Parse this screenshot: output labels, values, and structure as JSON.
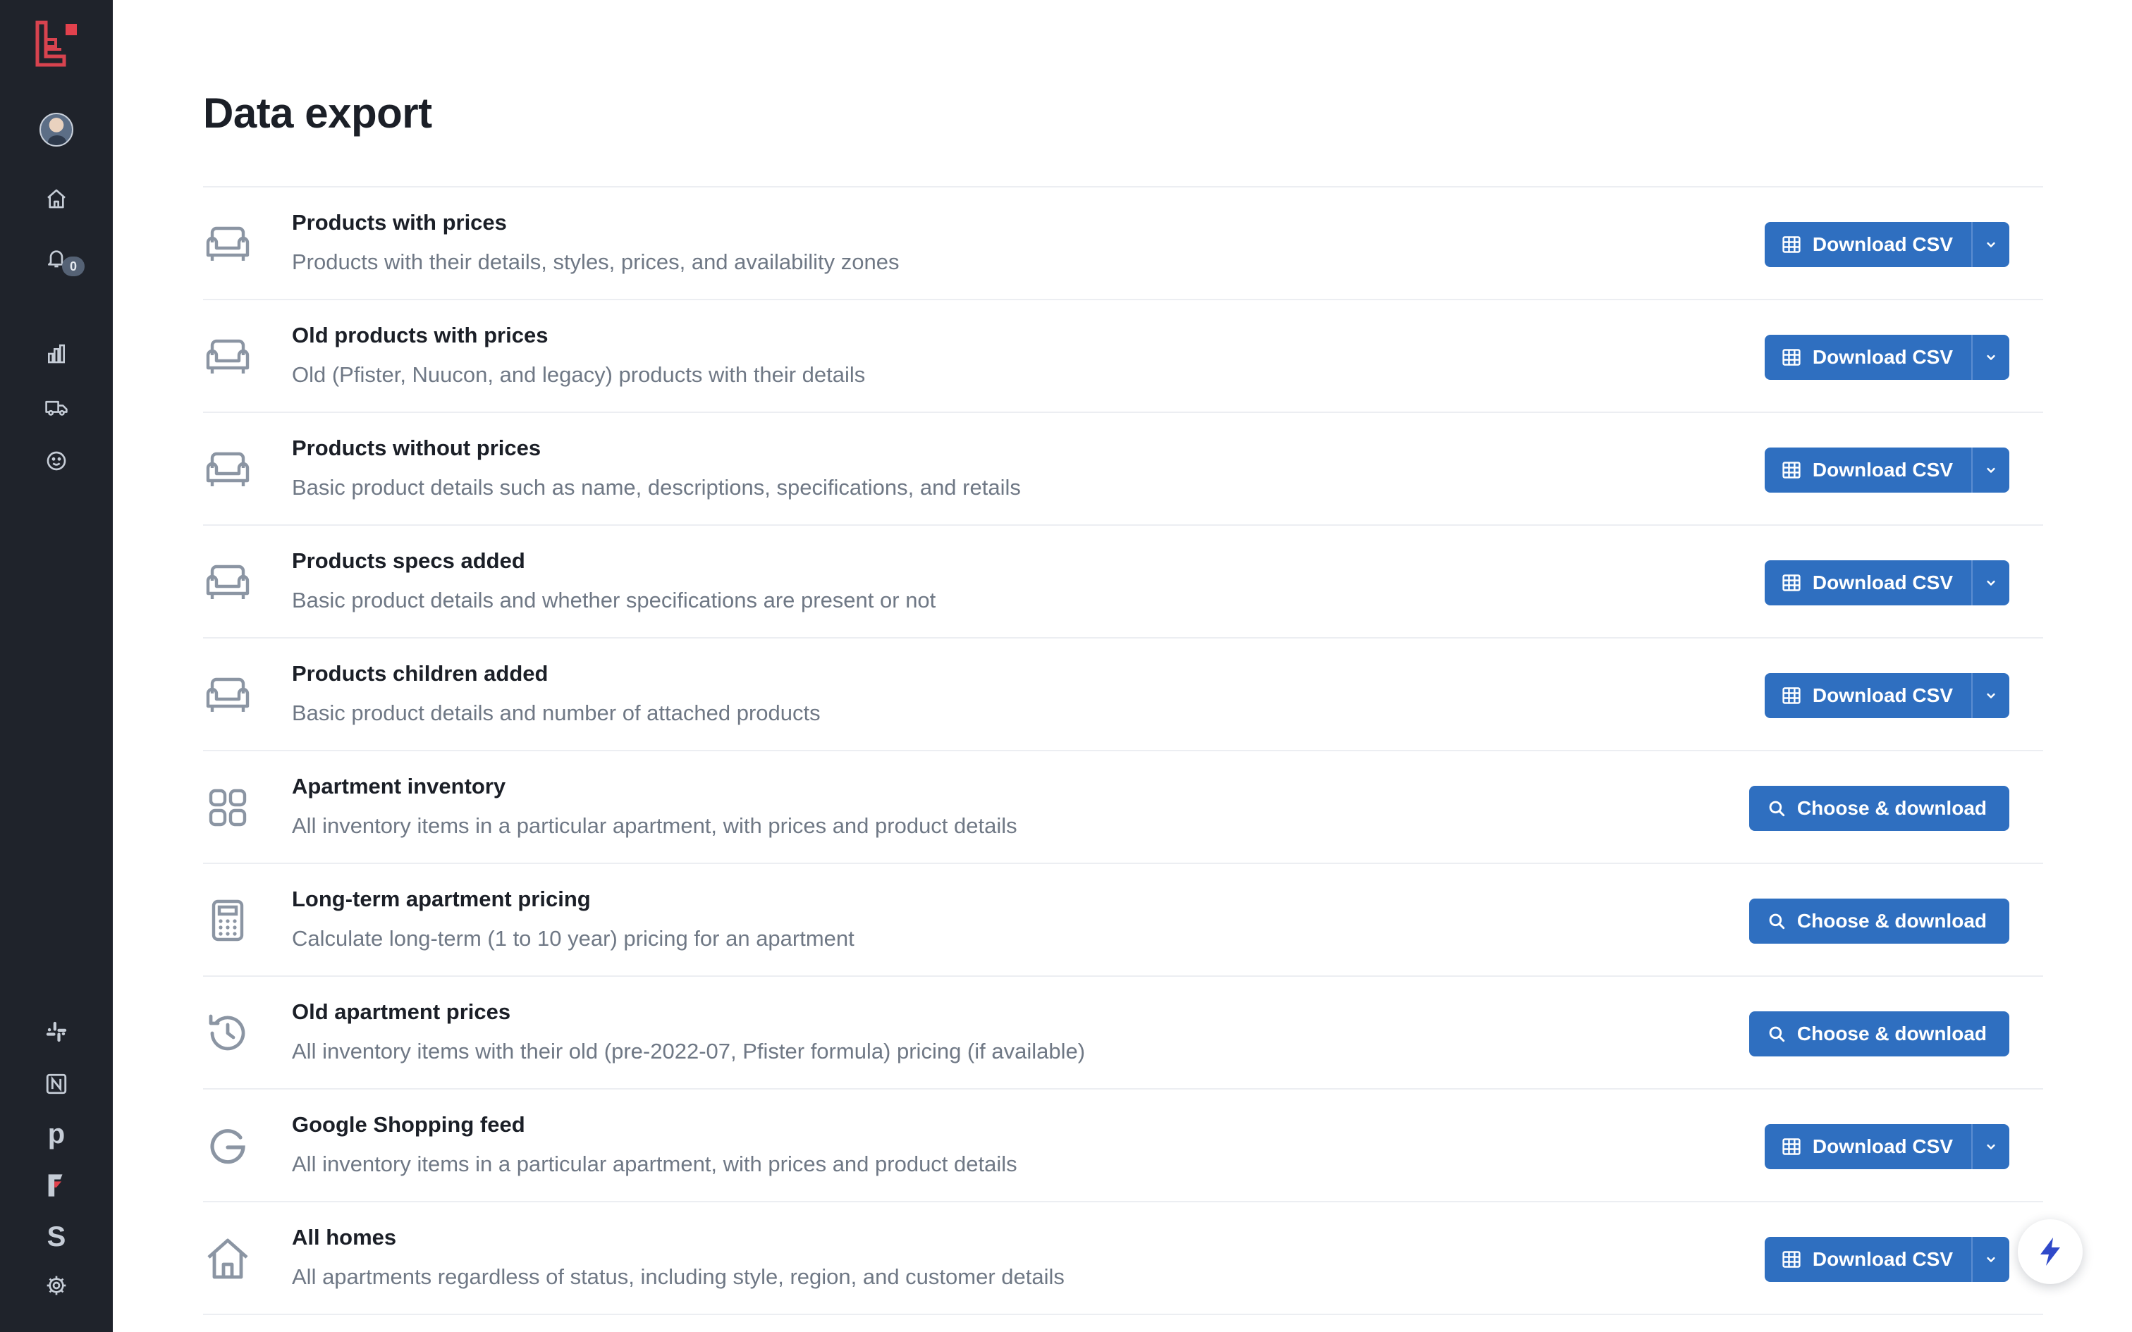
{
  "sidebar": {
    "notifications_count": "0",
    "external_letters": {
      "producthunt": "p",
      "stripe": "S"
    }
  },
  "page": {
    "title": "Data export"
  },
  "rows": [
    {
      "title": "Products with prices",
      "description": "Products with their details, styles, prices, and availability zones",
      "icon": "sofa-icon",
      "button": "Download CSV"
    },
    {
      "title": "Old products with prices",
      "description": "Old (Pfister, Nuucon, and legacy) products with their details",
      "icon": "sofa-icon",
      "button": "Download CSV"
    },
    {
      "title": "Products without prices",
      "description": "Basic product details such as name, descriptions, specifications, and retails",
      "icon": "sofa-icon",
      "button": "Download CSV"
    },
    {
      "title": "Products specs added",
      "description": "Basic product details and whether specifications are present or not",
      "icon": "sofa-icon",
      "button": "Download CSV"
    },
    {
      "title": "Products children added",
      "description": "Basic product details and number of attached products",
      "icon": "sofa-icon",
      "button": "Download CSV"
    },
    {
      "title": "Apartment inventory",
      "description": "All inventory items in a particular apartment, with prices and product details",
      "icon": "grid-icon",
      "button": "Choose & download"
    },
    {
      "title": "Long-term apartment pricing",
      "description": "Calculate long-term (1 to 10 year) pricing for an apartment",
      "icon": "calculator-icon",
      "button": "Choose & download"
    },
    {
      "title": "Old apartment prices",
      "description": "All inventory items with their old (pre-2022-07, Pfister formula) pricing (if available)",
      "icon": "history-icon",
      "button": "Choose & download"
    },
    {
      "title": "Google Shopping feed",
      "description": "All inventory items in a particular apartment, with prices and product details",
      "icon": "google-icon",
      "button": "Download CSV"
    },
    {
      "title": "All homes",
      "description": "All apartments regardless of status, including style, region, and customer details",
      "icon": "home-icon",
      "button": "Download CSV"
    }
  ],
  "colors": {
    "sidebar_bg": "#1f232b",
    "button_bg": "#2f6fc0",
    "accent_red": "#e2414d"
  }
}
